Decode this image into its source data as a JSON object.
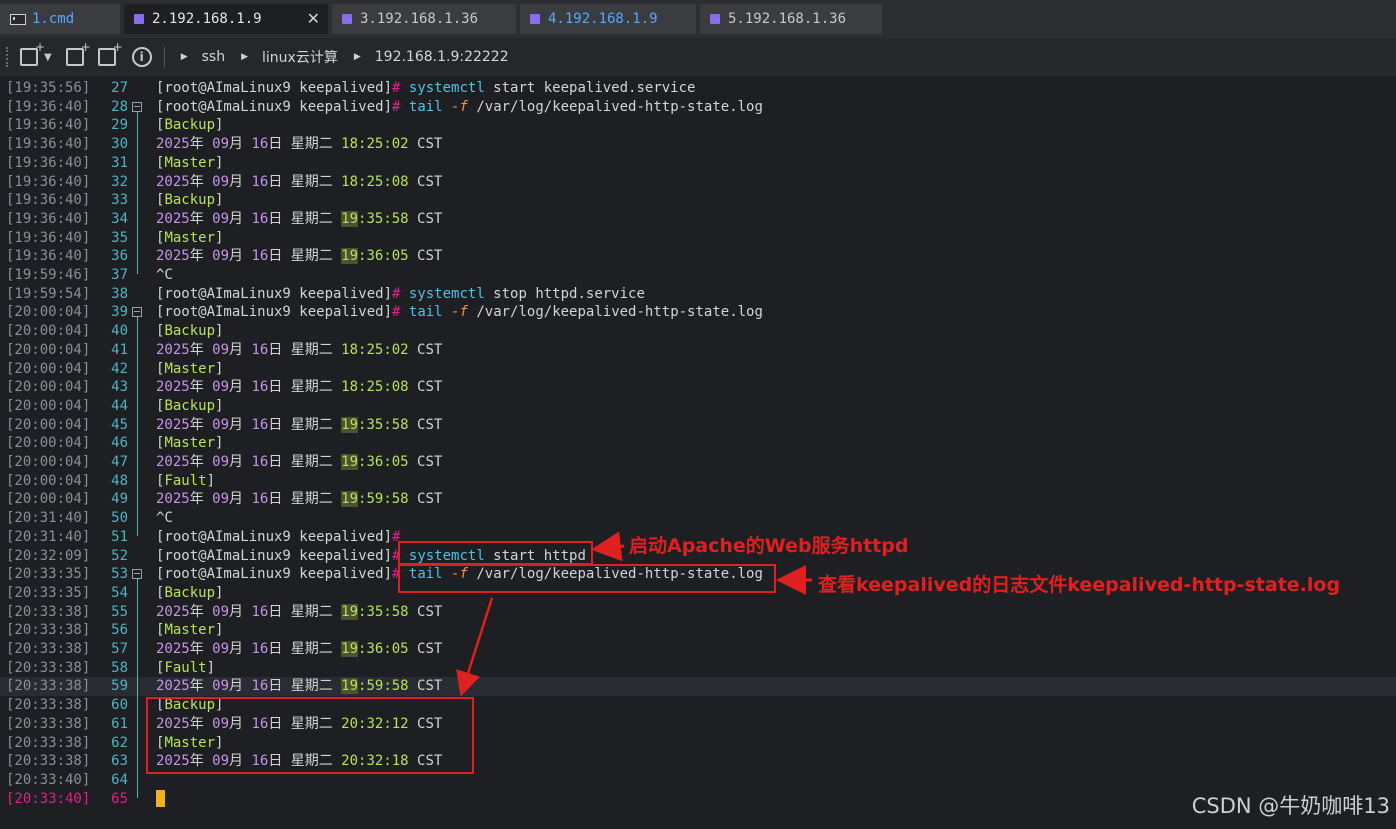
{
  "tabs": [
    {
      "label": "1.cmd",
      "kind": "cmd"
    },
    {
      "label": "2.192.168.1.9",
      "kind": "ssh",
      "active": true
    },
    {
      "label": "3.192.168.1.36",
      "kind": "ssh"
    },
    {
      "label": "4.192.168.1.9",
      "kind": "ssh"
    },
    {
      "label": "5.192.168.1.36",
      "kind": "ssh"
    }
  ],
  "toolbar": {
    "close_glyph": "✕",
    "info_glyph": "i",
    "breadcrumb": [
      "ssh",
      "linux云计算",
      "192.168.1.9:22222"
    ]
  },
  "terminal": {
    "prompt": "[root@AImaLinux9 keepalived]",
    "hash": "#",
    "lines": [
      {
        "ts": "[19:35:56]",
        "n": "27",
        "kind": "cmd",
        "cmd": "systemctl",
        "rest": " start keepalived.service"
      },
      {
        "ts": "[19:36:40]",
        "n": "28",
        "kind": "tail",
        "fold": true
      },
      {
        "ts": "[19:36:40]",
        "n": "29",
        "kind": "state",
        "state": "Backup"
      },
      {
        "ts": "[19:36:40]",
        "n": "30",
        "kind": "date",
        "time": "18:25:02",
        "thl": false
      },
      {
        "ts": "[19:36:40]",
        "n": "31",
        "kind": "state",
        "state": "Master"
      },
      {
        "ts": "[19:36:40]",
        "n": "32",
        "kind": "date",
        "time": "18:25:08",
        "thl": false
      },
      {
        "ts": "[19:36:40]",
        "n": "33",
        "kind": "state",
        "state": "Backup"
      },
      {
        "ts": "[19:36:40]",
        "n": "34",
        "kind": "date",
        "time": "19:35:58",
        "thl": true
      },
      {
        "ts": "[19:36:40]",
        "n": "35",
        "kind": "state",
        "state": "Master"
      },
      {
        "ts": "[19:36:40]",
        "n": "36",
        "kind": "date",
        "time": "19:36:05",
        "thl": true
      },
      {
        "ts": "[19:59:46]",
        "n": "37",
        "kind": "text",
        "text": "^C"
      },
      {
        "ts": "[19:59:54]",
        "n": "38",
        "kind": "cmd",
        "cmd": "systemctl",
        "rest": " stop httpd.service"
      },
      {
        "ts": "[20:00:04]",
        "n": "39",
        "kind": "tail",
        "fold": true
      },
      {
        "ts": "[20:00:04]",
        "n": "40",
        "kind": "state",
        "state": "Backup"
      },
      {
        "ts": "[20:00:04]",
        "n": "41",
        "kind": "date",
        "time": "18:25:02",
        "thl": false
      },
      {
        "ts": "[20:00:04]",
        "n": "42",
        "kind": "state",
        "state": "Master"
      },
      {
        "ts": "[20:00:04]",
        "n": "43",
        "kind": "date",
        "time": "18:25:08",
        "thl": false
      },
      {
        "ts": "[20:00:04]",
        "n": "44",
        "kind": "state",
        "state": "Backup"
      },
      {
        "ts": "[20:00:04]",
        "n": "45",
        "kind": "date",
        "time": "19:35:58",
        "thl": true
      },
      {
        "ts": "[20:00:04]",
        "n": "46",
        "kind": "state",
        "state": "Master"
      },
      {
        "ts": "[20:00:04]",
        "n": "47",
        "kind": "date",
        "time": "19:36:05",
        "thl": true
      },
      {
        "ts": "[20:00:04]",
        "n": "48",
        "kind": "state",
        "state": "Fault"
      },
      {
        "ts": "[20:00:04]",
        "n": "49",
        "kind": "date",
        "time": "19:59:58",
        "thl": true
      },
      {
        "ts": "[20:31:40]",
        "n": "50",
        "kind": "text",
        "text": "^C"
      },
      {
        "ts": "[20:31:40]",
        "n": "51",
        "kind": "prompt"
      },
      {
        "ts": "[20:32:09]",
        "n": "52",
        "kind": "cmd",
        "cmd": "systemctl",
        "rest": " start httpd"
      },
      {
        "ts": "[20:33:35]",
        "n": "53",
        "kind": "tail",
        "fold": true
      },
      {
        "ts": "[20:33:35]",
        "n": "54",
        "kind": "state",
        "state": "Backup"
      },
      {
        "ts": "[20:33:38]",
        "n": "55",
        "kind": "date",
        "time": "19:35:58",
        "thl": true
      },
      {
        "ts": "[20:33:38]",
        "n": "56",
        "kind": "state",
        "state": "Master"
      },
      {
        "ts": "[20:33:38]",
        "n": "57",
        "kind": "date",
        "time": "19:36:05",
        "thl": true
      },
      {
        "ts": "[20:33:38]",
        "n": "58",
        "kind": "state",
        "state": "Fault"
      },
      {
        "ts": "[20:33:38]",
        "n": "59",
        "kind": "date",
        "time": "19:59:58",
        "thl": true,
        "highlight": true
      },
      {
        "ts": "[20:33:38]",
        "n": "60",
        "kind": "state",
        "state": "Backup"
      },
      {
        "ts": "[20:33:38]",
        "n": "61",
        "kind": "date",
        "time": "20:32:12",
        "thl": false
      },
      {
        "ts": "[20:33:38]",
        "n": "62",
        "kind": "state",
        "state": "Master"
      },
      {
        "ts": "[20:33:38]",
        "n": "63",
        "kind": "date",
        "time": "20:32:18",
        "thl": false
      },
      {
        "ts": "[20:33:40]",
        "n": "64",
        "kind": "empty"
      },
      {
        "ts": "[20:33:40]",
        "n": "65",
        "kind": "cursor",
        "last": true
      }
    ],
    "tail_cmd": "tail",
    "tail_flag": "-f",
    "tail_path": " /var/log/keepalived-http-state.log",
    "date_year": "2025",
    "date_month": "09",
    "date_day": "16",
    "date_weekday": "星期二",
    "date_tz": "CST"
  },
  "annotations": {
    "start_httpd": "启动Apache的Web服务httpd",
    "view_log": "查看keepalived的日志文件keepalived-http-state.log"
  },
  "watermark": "CSDN @牛奶咖啡13",
  "colors": {
    "annotation_red": "#e02020",
    "cursor": "#f2b01e",
    "tab_icon": "#8a6cf0"
  }
}
